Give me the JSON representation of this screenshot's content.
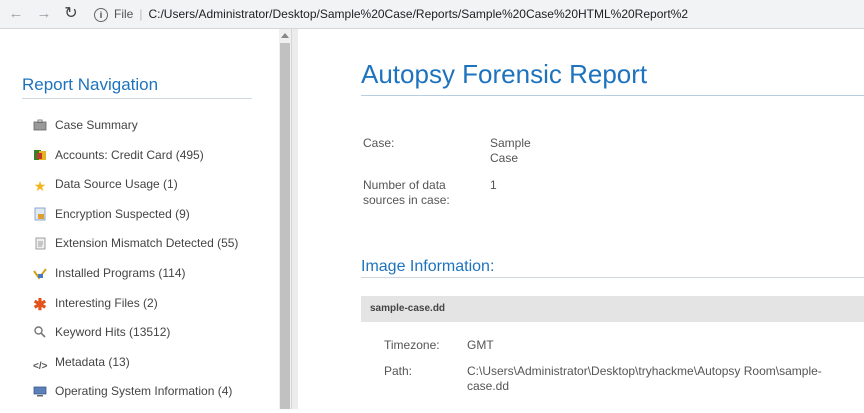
{
  "browser": {
    "back_icon": "arrow-left-icon",
    "forward_icon": "arrow-right-icon",
    "reload_icon": "reload-icon",
    "info_icon": "info-icon",
    "scheme": "File",
    "url": "C:/Users/Administrator/Desktop/Sample%20Case/Reports/Sample%20Case%20HTML%20Report%2"
  },
  "sidebar": {
    "title": "Report Navigation",
    "items": [
      {
        "label": "Case Summary",
        "icon": "briefcase-icon"
      },
      {
        "label": "Accounts: Credit Card (495)",
        "icon": "credit-card-icon"
      },
      {
        "label": "Data Source Usage (1)",
        "icon": "star-icon"
      },
      {
        "label": "Encryption Suspected (9)",
        "icon": "lock-document-icon"
      },
      {
        "label": "Extension Mismatch Detected (55)",
        "icon": "file-mismatch-icon"
      },
      {
        "label": "Installed Programs (114)",
        "icon": "installed-programs-icon"
      },
      {
        "label": "Interesting Files (2)",
        "icon": "asterisk-icon"
      },
      {
        "label": "Keyword Hits (13512)",
        "icon": "magnifier-icon"
      },
      {
        "label": "Metadata (13)",
        "icon": "code-tag-icon"
      },
      {
        "label": "Operating System Information (4)",
        "icon": "computer-icon"
      }
    ]
  },
  "main": {
    "title": "Autopsy Forensic Report",
    "case_label": "Case:",
    "case_value_line1": "Sample",
    "case_value_line2": "Case",
    "sources_label_line1": "Number of data",
    "sources_label_line2": "sources in case:",
    "sources_value": "1",
    "image_section_title": "Image Information:",
    "image_name": "sample-case.dd",
    "timezone_label": "Timezone:",
    "timezone_value": "GMT",
    "path_label": "Path:",
    "path_value_line1": "C:\\Users\\Administrator\\Desktop\\tryhackme\\Autopsy Room\\sample-",
    "path_value_line2": "case.dd"
  },
  "colors": {
    "accent": "#1e73be",
    "image_bar": "#e4e4e4"
  }
}
